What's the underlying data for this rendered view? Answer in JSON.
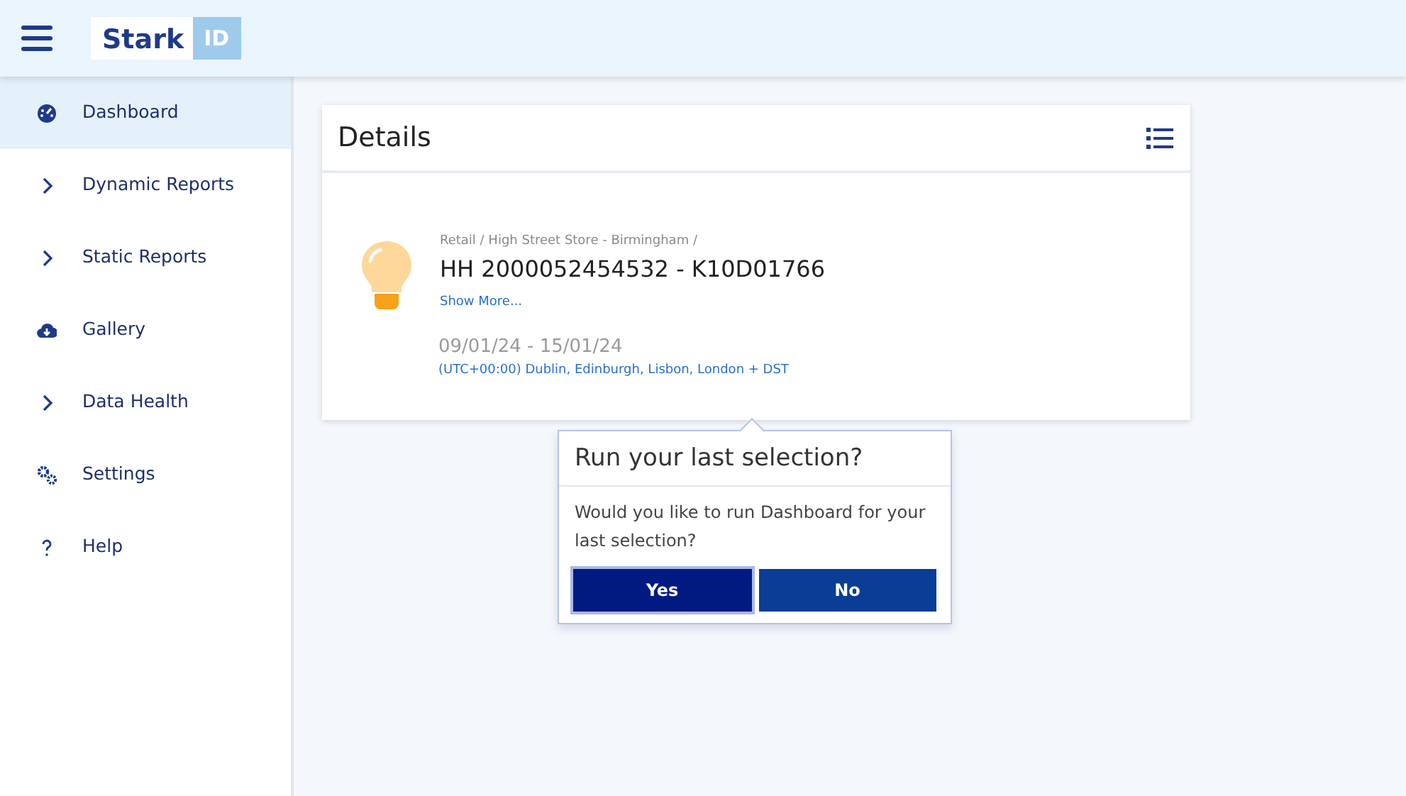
{
  "header": {
    "logo": {
      "name": "Stark",
      "tag": "ID"
    }
  },
  "sidebar": {
    "items": [
      {
        "label": "Dashboard",
        "kind": "dashboard",
        "selected": true
      },
      {
        "label": "Dynamic Reports",
        "kind": "group",
        "selected": false
      },
      {
        "label": "Static Reports",
        "kind": "group",
        "selected": false
      },
      {
        "label": "Gallery",
        "kind": "gallery",
        "selected": false
      },
      {
        "label": "Data Health",
        "kind": "group",
        "selected": false
      },
      {
        "label": "Settings",
        "kind": "settings",
        "selected": false
      },
      {
        "label": "Help",
        "kind": "help",
        "selected": false
      }
    ]
  },
  "details": {
    "title": "Details",
    "path": "Retail / High Street Store - Birmingham /",
    "meter": "HH 2000052454532 - K10D01766",
    "show_more": "Show More...",
    "date_range": "09/01/24 - 15/01/24",
    "timezone": "(UTC+00:00) Dublin, Edinburgh, Lisbon, London + DST"
  },
  "popover": {
    "title": "Run your last selection?",
    "message": "Would you like to run Dashboard for your last selection?",
    "buttons": [
      {
        "label": "Yes",
        "focused": true
      },
      {
        "label": "No",
        "focused": false
      }
    ]
  }
}
